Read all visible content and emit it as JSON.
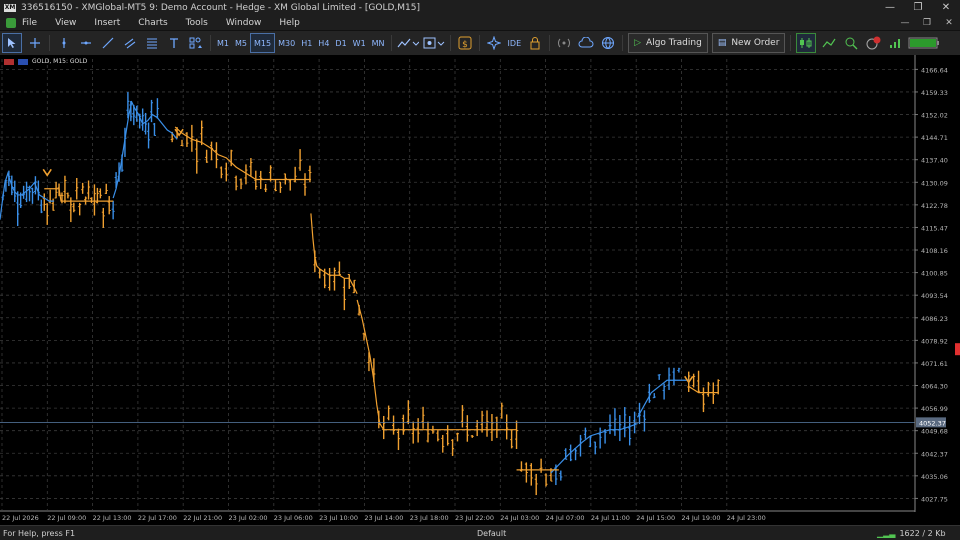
{
  "window": {
    "logo_text": "XM",
    "title": "336516150 - XMGlobal-MT5 9: Demo Account - Hedge - XM Global Limited - [GOLD,M15]",
    "min_glyph": "—",
    "restore_glyph": "❐",
    "close_glyph": "✕"
  },
  "menu": {
    "items": [
      "File",
      "View",
      "Insert",
      "Charts",
      "Tools",
      "Window",
      "Help"
    ],
    "mdi_min": "—",
    "mdi_restore": "❐",
    "mdi_close": "✕"
  },
  "toolbar": {
    "timeframes": [
      "M1",
      "M5",
      "M15",
      "M30",
      "H1",
      "H4",
      "D1",
      "W1",
      "MN"
    ],
    "selected_timeframe": "M15",
    "ide_label": "IDE",
    "algo_trading_label": "Algo Trading",
    "new_order_label": "New Order",
    "icons": {
      "cursor": "cursor-icon",
      "crosshair": "crosshair-icon",
      "vline": "vertical-line-icon",
      "hline": "horizontal-line-icon",
      "trend": "trendline-icon",
      "channel": "channel-icon",
      "fibo": "fibonacci-icon",
      "text": "text-icon",
      "shapes": "shapes-icon",
      "indicator": "indicators-icon",
      "template": "template-icon",
      "market": "market-icon",
      "signals": "signals-icon",
      "vps": "vps-icon",
      "lock": "lock-icon",
      "radio": "radio-icon",
      "cloud": "cloud-icon",
      "globe": "globe-icon"
    }
  },
  "chart": {
    "symbol_label": "GOLD, M15:  GOLD",
    "current_price": "4052.37",
    "grid": true,
    "colors": {
      "background": "#000000",
      "grid": "#3a3a3a",
      "bull": "#3a8fe8",
      "bear": "#f0a030",
      "axis_text": "#b8b8b8",
      "price_line": "#5a7fa8"
    }
  },
  "chart_data": {
    "type": "line",
    "title": "",
    "xlabel": "",
    "ylabel": "",
    "y_ticks": [
      "4166.64",
      "4159.33",
      "4152.02",
      "4144.71",
      "4137.40",
      "4130.09",
      "4122.78",
      "4115.47",
      "4108.16",
      "4100.85",
      "4093.54",
      "4086.23",
      "4078.92",
      "4071.61",
      "4064.30",
      "4056.99",
      "4049.68",
      "4042.37",
      "4035.06",
      "4027.75"
    ],
    "ylim": [
      4024.0,
      4170.0
    ],
    "x_ticks": [
      "22 Jul 2026",
      "22 Jul 09:00",
      "22 Jul 13:00",
      "22 Jul 17:00",
      "22 Jul 21:00",
      "23 Jul 02:00",
      "23 Jul 06:00",
      "23 Jul 10:00",
      "23 Jul 14:00",
      "23 Jul 18:00",
      "23 Jul 22:00",
      "24 Jul 03:00",
      "24 Jul 07:00",
      "24 Jul 11:00",
      "24 Jul 15:00",
      "24 Jul 19:00",
      "24 Jul 23:00"
    ],
    "series": [
      {
        "color": "#3a8fe8",
        "x": [
          0,
          2,
          5,
          8,
          12,
          15,
          18,
          22,
          26,
          30,
          35,
          40,
          45,
          50,
          55
        ],
        "y": [
          4118,
          4123,
          4130,
          4133,
          4129,
          4127,
          4126,
          4126,
          4127,
          4128,
          4130,
          4126,
          4125,
          4124,
          4124
        ]
      },
      {
        "color": "#3a8fe8",
        "x": [
          115,
          118,
          122,
          125,
          128,
          131,
          134,
          137,
          141,
          145,
          150,
          155,
          160,
          165,
          170,
          175,
          180
        ],
        "y": [
          4125,
          4128,
          4134,
          4140,
          4146,
          4152,
          4156,
          4154,
          4152,
          4149,
          4150,
          4152,
          4151,
          4149,
          4147,
          4146,
          4144
        ]
      },
      {
        "color": "#3a8fe8",
        "x": [
          560,
          566,
          572,
          578,
          585,
          592,
          600,
          610,
          620,
          630,
          640,
          648
        ],
        "y": [
          4036,
          4038,
          4040,
          4042,
          4044,
          4046,
          4048,
          4049,
          4050,
          4050,
          4051,
          4052
        ]
      },
      {
        "color": "#3a8fe8",
        "x": [
          648,
          655,
          662,
          670,
          678,
          686,
          694,
          700
        ],
        "y": [
          4054,
          4058,
          4062,
          4064,
          4066,
          4066,
          4066,
          4066
        ]
      },
      {
        "color": "#f0a030",
        "x": [
          45,
          50,
          55,
          60,
          62,
          70,
          80,
          90,
          100,
          110,
          115
        ],
        "y": [
          4128,
          4128,
          4128,
          4128,
          4124,
          4124,
          4124,
          4124,
          4124,
          4124,
          4124
        ]
      },
      {
        "color": "#f0a030",
        "x": [
          178,
          185,
          195,
          205,
          215,
          222,
          230,
          240,
          250,
          260,
          270,
          280,
          290,
          300,
          310,
          316
        ],
        "y": [
          4148,
          4146,
          4144,
          4143,
          4141,
          4139,
          4138,
          4135,
          4133,
          4131,
          4131,
          4131,
          4131,
          4131,
          4131,
          4131
        ]
      },
      {
        "color": "#f0a030",
        "x": [
          316,
          318,
          320,
          322,
          325,
          330,
          335,
          340,
          345,
          350,
          355,
          360,
          363
        ],
        "y": [
          4120,
          4112,
          4106,
          4103,
          4102,
          4101,
          4100,
          4100,
          4100,
          4099,
          4099,
          4096,
          4094
        ]
      },
      {
        "color": "#f0a030",
        "x": [
          363,
          368,
          372,
          376,
          380,
          383,
          386,
          390,
          395,
          400,
          410,
          420,
          440,
          460,
          480,
          500,
          520,
          525
        ],
        "y": [
          4092,
          4086,
          4080,
          4074,
          4066,
          4058,
          4052,
          4050,
          4050,
          4050,
          4050,
          4050,
          4050,
          4050,
          4050,
          4050,
          4050,
          4050
        ]
      },
      {
        "color": "#f0a030",
        "x": [
          525,
          530,
          540,
          550,
          560,
          568
        ],
        "y": [
          4037,
          4037,
          4037,
          4037,
          4037,
          4037
        ]
      },
      {
        "color": "#f0a030",
        "x": [
          700,
          705,
          710,
          720,
          730
        ],
        "y": [
          4064,
          4063,
          4062,
          4062,
          4062
        ]
      }
    ],
    "price_candles_bull_x": [
      3,
      6,
      9,
      12,
      15,
      18,
      21,
      24,
      27,
      30,
      33,
      36,
      39,
      42,
      115,
      118,
      121,
      124,
      127,
      130,
      133,
      136,
      139,
      142,
      145,
      148,
      151,
      154,
      157,
      160,
      565,
      570,
      575,
      580,
      585,
      590,
      595,
      600,
      605,
      610,
      615,
      620,
      625,
      630,
      635,
      640,
      645,
      650,
      655,
      660,
      665,
      670,
      675,
      680,
      685,
      690
    ],
    "price_candles_bear_x": [
      45,
      48,
      51,
      54,
      57,
      60,
      63,
      66,
      69,
      72,
      75,
      78,
      81,
      84,
      87,
      90,
      93,
      96,
      99,
      102,
      105,
      108,
      111,
      175,
      180,
      185,
      190,
      195,
      200,
      205,
      210,
      215,
      220,
      225,
      230,
      235,
      240,
      245,
      250,
      255,
      260,
      265,
      270,
      275,
      280,
      285,
      290,
      295,
      300,
      305,
      310,
      315,
      320,
      325,
      330,
      335,
      340,
      345,
      350,
      355,
      360,
      365,
      370,
      375,
      380,
      385,
      390,
      395,
      400,
      405,
      410,
      415,
      420,
      425,
      430,
      435,
      440,
      445,
      450,
      455,
      460,
      465,
      470,
      475,
      480,
      485,
      490,
      495,
      500,
      505,
      510,
      515,
      520,
      525,
      530,
      535,
      540,
      545,
      550,
      555,
      560,
      700,
      705,
      710,
      715,
      720,
      725,
      730
    ]
  },
  "status": {
    "help_text": "For Help, press F1",
    "profile": "Default",
    "traffic": "1622 / 2 Kb"
  }
}
